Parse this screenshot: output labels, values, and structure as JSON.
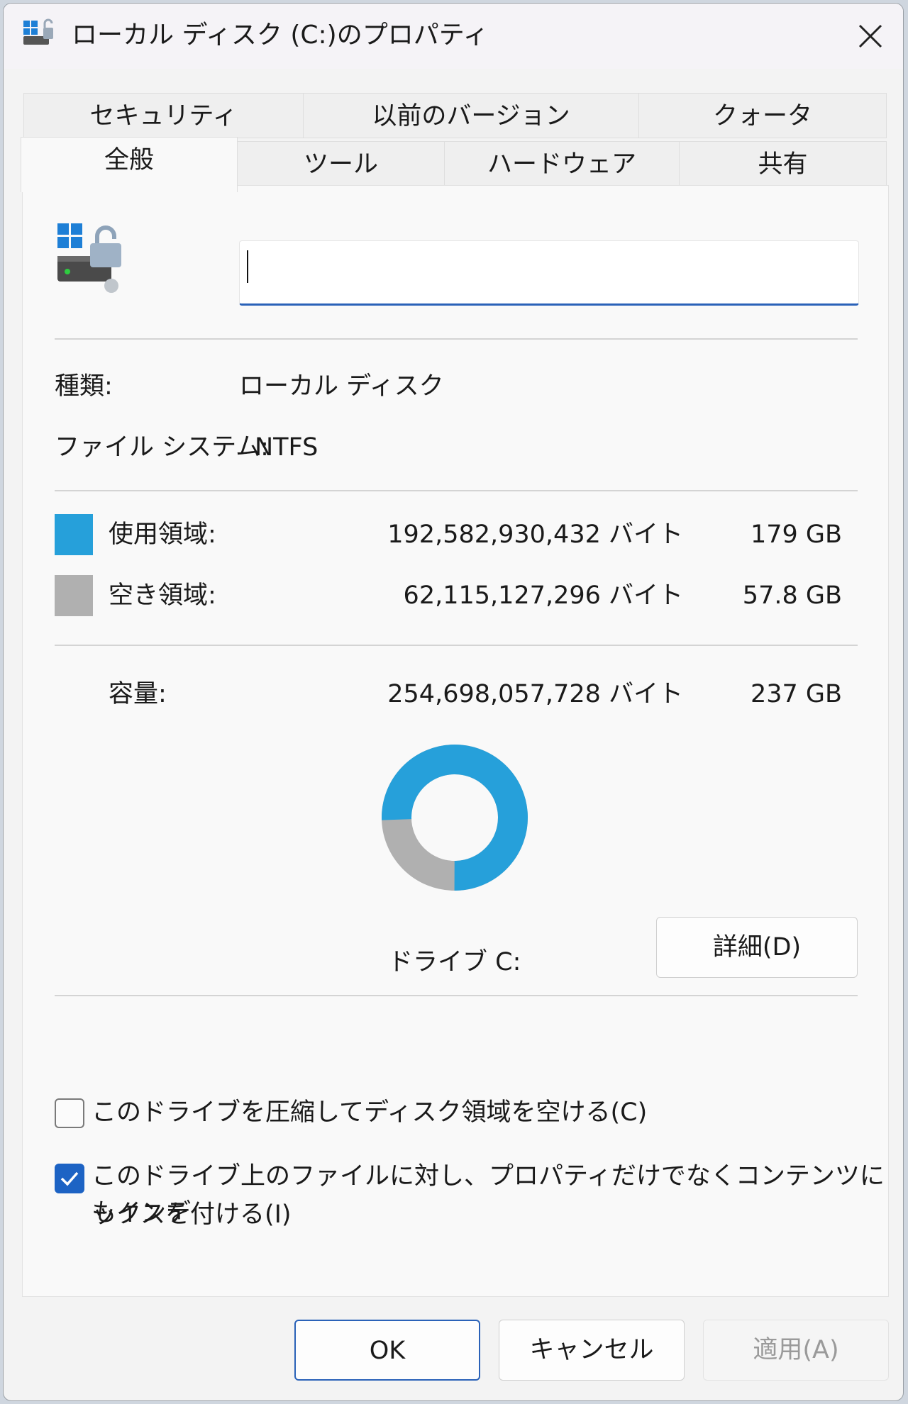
{
  "window": {
    "title": "ローカル ディスク (C:)のプロパティ"
  },
  "tabs_row1": [
    {
      "label": "セキュリティ"
    },
    {
      "label": "以前のバージョン"
    },
    {
      "label": "クォータ"
    }
  ],
  "tabs_row2": [
    {
      "label": "全般",
      "active": true
    },
    {
      "label": "ツール"
    },
    {
      "label": "ハードウェア"
    },
    {
      "label": "共有"
    }
  ],
  "general": {
    "name_value": "",
    "type_label": "種類:",
    "type_value": "ローカル ディスク",
    "fs_label": "ファイル システム:",
    "fs_value": "NTFS",
    "used_label": "使用領域:",
    "used_bytes": "192,582,930,432 バイト",
    "used_size": "179 GB",
    "free_label": "空き領域:",
    "free_bytes": "62,115,127,296 バイト",
    "free_size": "57.8 GB",
    "capacity_label": "容量:",
    "capacity_bytes": "254,698,057,728 バイト",
    "capacity_size": "237 GB",
    "drive_label": "ドライブ C:",
    "details_button": "詳細(D)",
    "compress_checkbox": {
      "label": "このドライブを圧縮してディスク領域を空ける(C)",
      "checked": false
    },
    "index_checkbox": {
      "label_line1": "このドライブ上のファイルに対し、プロパティだけでなくコンテンツにもインデ",
      "label_line2": "ックスを付ける(I)",
      "checked": true
    },
    "usage_fraction": 0.756
  },
  "colors": {
    "used": "#26a0da",
    "free": "#b0b0b0",
    "accent": "#2a62b8"
  },
  "buttons": {
    "ok": "OK",
    "cancel": "キャンセル",
    "apply": "適用(A)"
  }
}
